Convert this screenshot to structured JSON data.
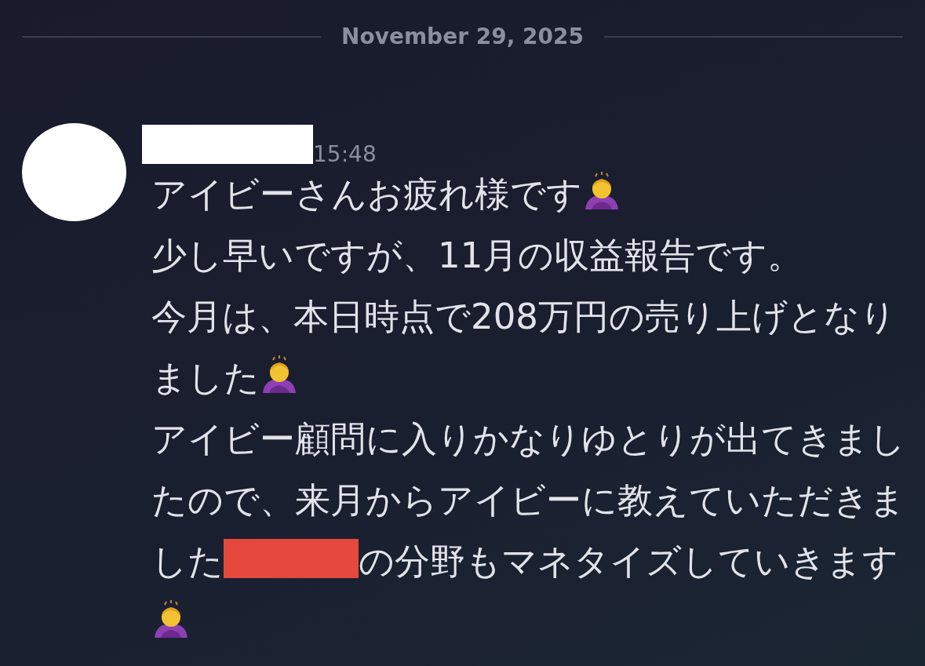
{
  "date_divider": "November 29, 2025",
  "message": {
    "time": "15:48",
    "paragraphs": [
      [
        {
          "kind": "text",
          "text": "アイビーさんお疲れ様です"
        },
        {
          "kind": "emoji"
        }
      ],
      [
        {
          "kind": "text",
          "text": "少し早いですが、11月の収益報告です。"
        }
      ],
      [
        {
          "kind": "text",
          "text": "今月は、本日時点で208万円の売り上げとなりました"
        },
        {
          "kind": "emoji"
        }
      ],
      [
        {
          "kind": "text",
          "text": "アイビー顧問に入りかなりゆとりが出てきましたので、来月からアイビーに教えていただきました"
        },
        {
          "kind": "redaction"
        },
        {
          "kind": "text",
          "text": "の分野もマネタイズしていきます"
        },
        {
          "kind": "emoji"
        }
      ]
    ]
  }
}
